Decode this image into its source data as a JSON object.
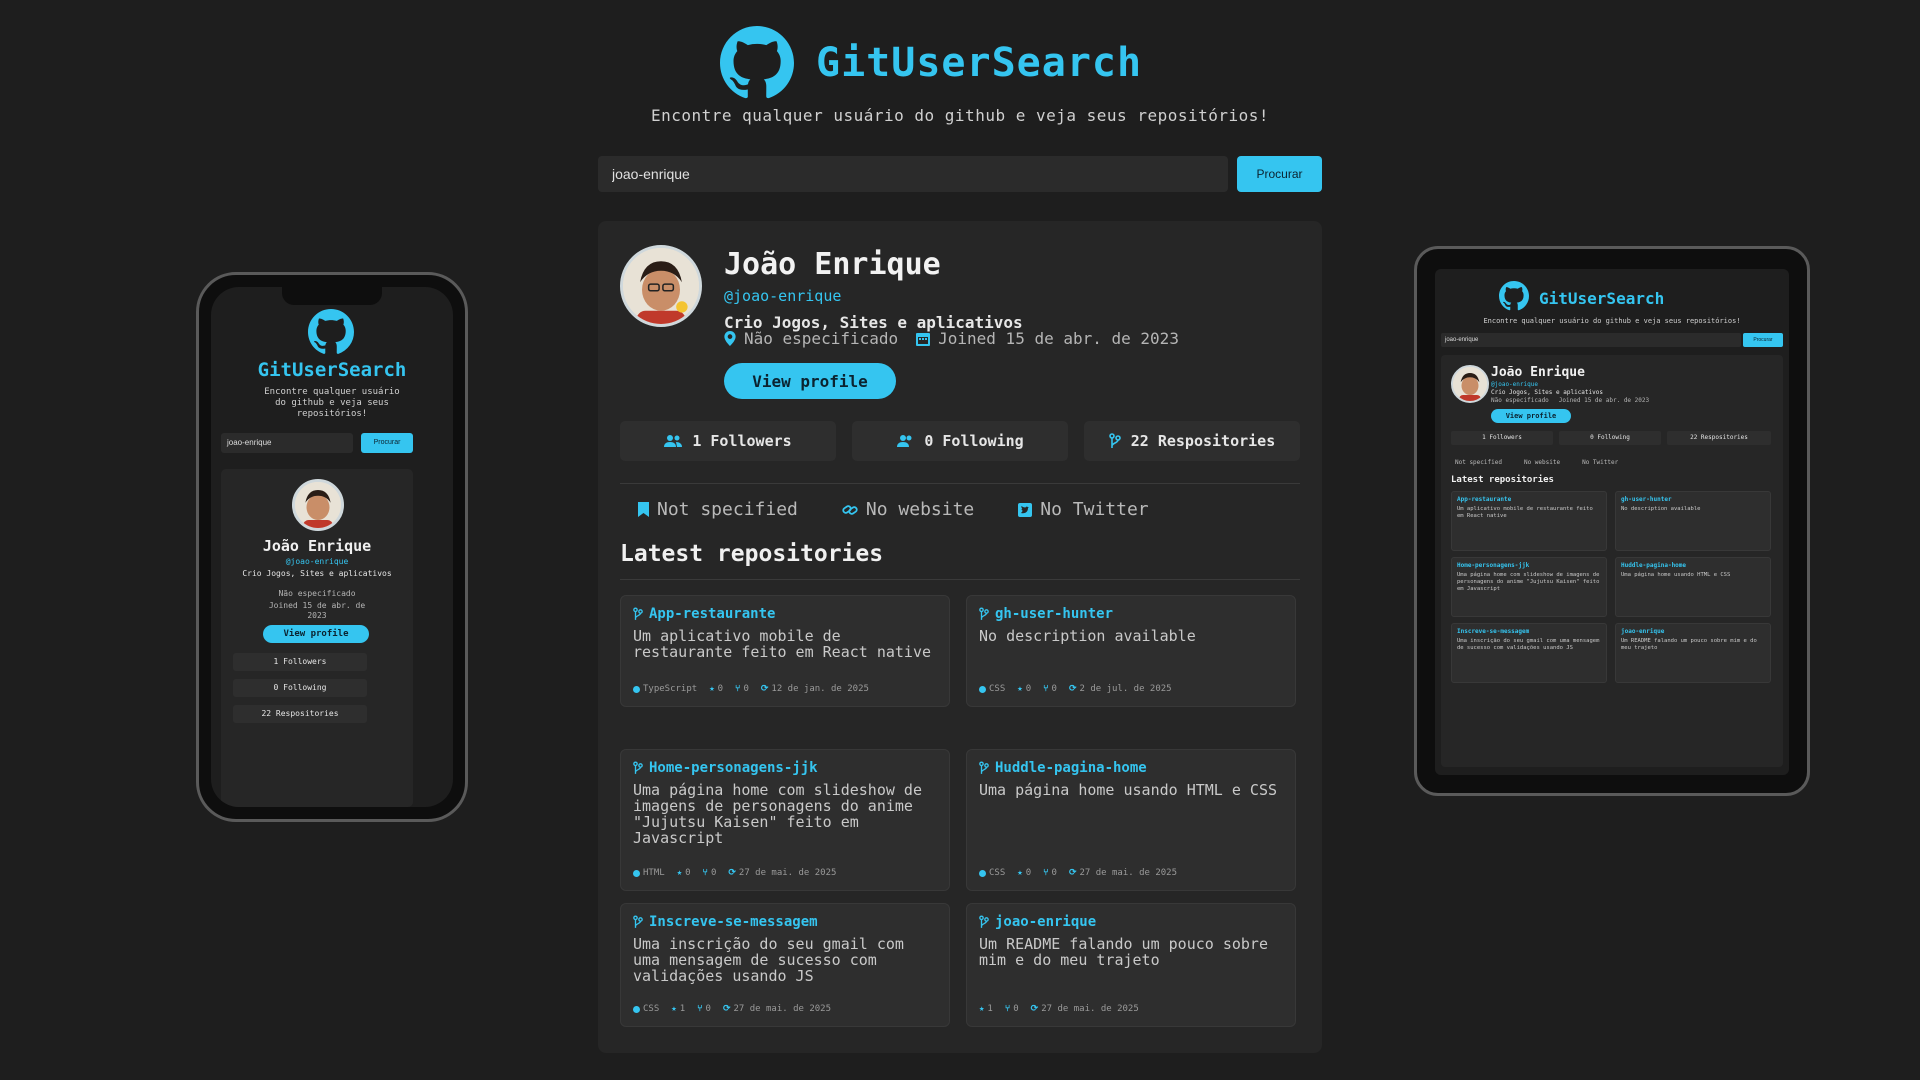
{
  "app": {
    "name": "GitUserSearch",
    "tagline": "Encontre qualquer usuário do github e veja seus repositórios!"
  },
  "search": {
    "value": "joao-enrique",
    "button": "Procurar"
  },
  "profile": {
    "name": "João Enrique",
    "login": "@joao-enrique",
    "bio": "Crio Jogos, Sites e aplicativos",
    "location": "Não especificado",
    "joined": "Joined 15 de abr. de 2023",
    "view_profile": "View profile",
    "stats": {
      "followers": "1 Followers",
      "following": "0 Following",
      "repos": "22 Respositories"
    },
    "links": {
      "company": "Not specified",
      "website": "No website",
      "twitter": "No Twitter"
    }
  },
  "latest_title": "Latest repositories",
  "repos": [
    {
      "name": "App-restaurante",
      "desc": "Um aplicativo mobile de restaurante feito em React native",
      "lang": "TypeScript",
      "stars": "0",
      "forks": "0",
      "updated": "12 de jan. de 2025"
    },
    {
      "name": "gh-user-hunter",
      "desc": "No description available",
      "lang": "CSS",
      "stars": "0",
      "forks": "0",
      "updated": "2 de jul. de 2025"
    },
    {
      "name": "Home-personagens-jjk",
      "desc": "Uma página home com slideshow de imagens de personagens do anime \"Jujutsu Kaisen\" feito em Javascript",
      "lang": "HTML",
      "stars": "0",
      "forks": "0",
      "updated": "27 de mai. de 2025"
    },
    {
      "name": "Huddle-pagina-home",
      "desc": "Uma página home usando HTML e CSS",
      "lang": "CSS",
      "stars": "0",
      "forks": "0",
      "updated": "27 de mai. de 2025"
    },
    {
      "name": "Inscreve-se-messagem",
      "desc": "Uma inscrição do seu gmail com uma mensagem de sucesso com validações usando JS",
      "lang": "CSS",
      "stars": "1",
      "forks": "0",
      "updated": "27 de mai. de 2025"
    },
    {
      "name": "joao-enrique",
      "desc": "Um README falando um pouco sobre mim e do meu trajeto",
      "lang": "",
      "stars": "1",
      "forks": "0",
      "updated": "27 de mai. de 2025"
    }
  ],
  "mobile": {
    "tagline_lines": [
      "Encontre qualquer usuário",
      "do github e veja seus",
      "repositórios!"
    ],
    "joined_lines": [
      "Joined 15 de abr. de",
      "2023"
    ]
  },
  "colors": {
    "accent": "#35c5f0",
    "background": "#1e1e1e",
    "card": "#262626"
  },
  "icons": [
    "github-icon",
    "location-icon",
    "calendar-icon",
    "users-icon",
    "user-icon",
    "repo-icon",
    "bookmark-icon",
    "link-icon",
    "twitter-icon",
    "star-icon",
    "fork-icon",
    "clock-icon"
  ]
}
